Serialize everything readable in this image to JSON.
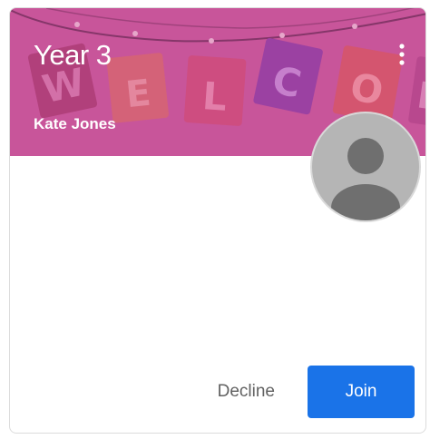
{
  "card": {
    "class_name": "Year 3",
    "teacher_name": "Kate Jones",
    "banner_color": "#c8559a",
    "banner_letters": [
      "W",
      "E",
      "L",
      "C",
      "O",
      "M"
    ],
    "more_icon": "more-vert-icon",
    "avatar_icon": "default-user-avatar"
  },
  "actions": {
    "decline_label": "Decline",
    "join_label": "Join",
    "join_color": "#1a73e8"
  }
}
